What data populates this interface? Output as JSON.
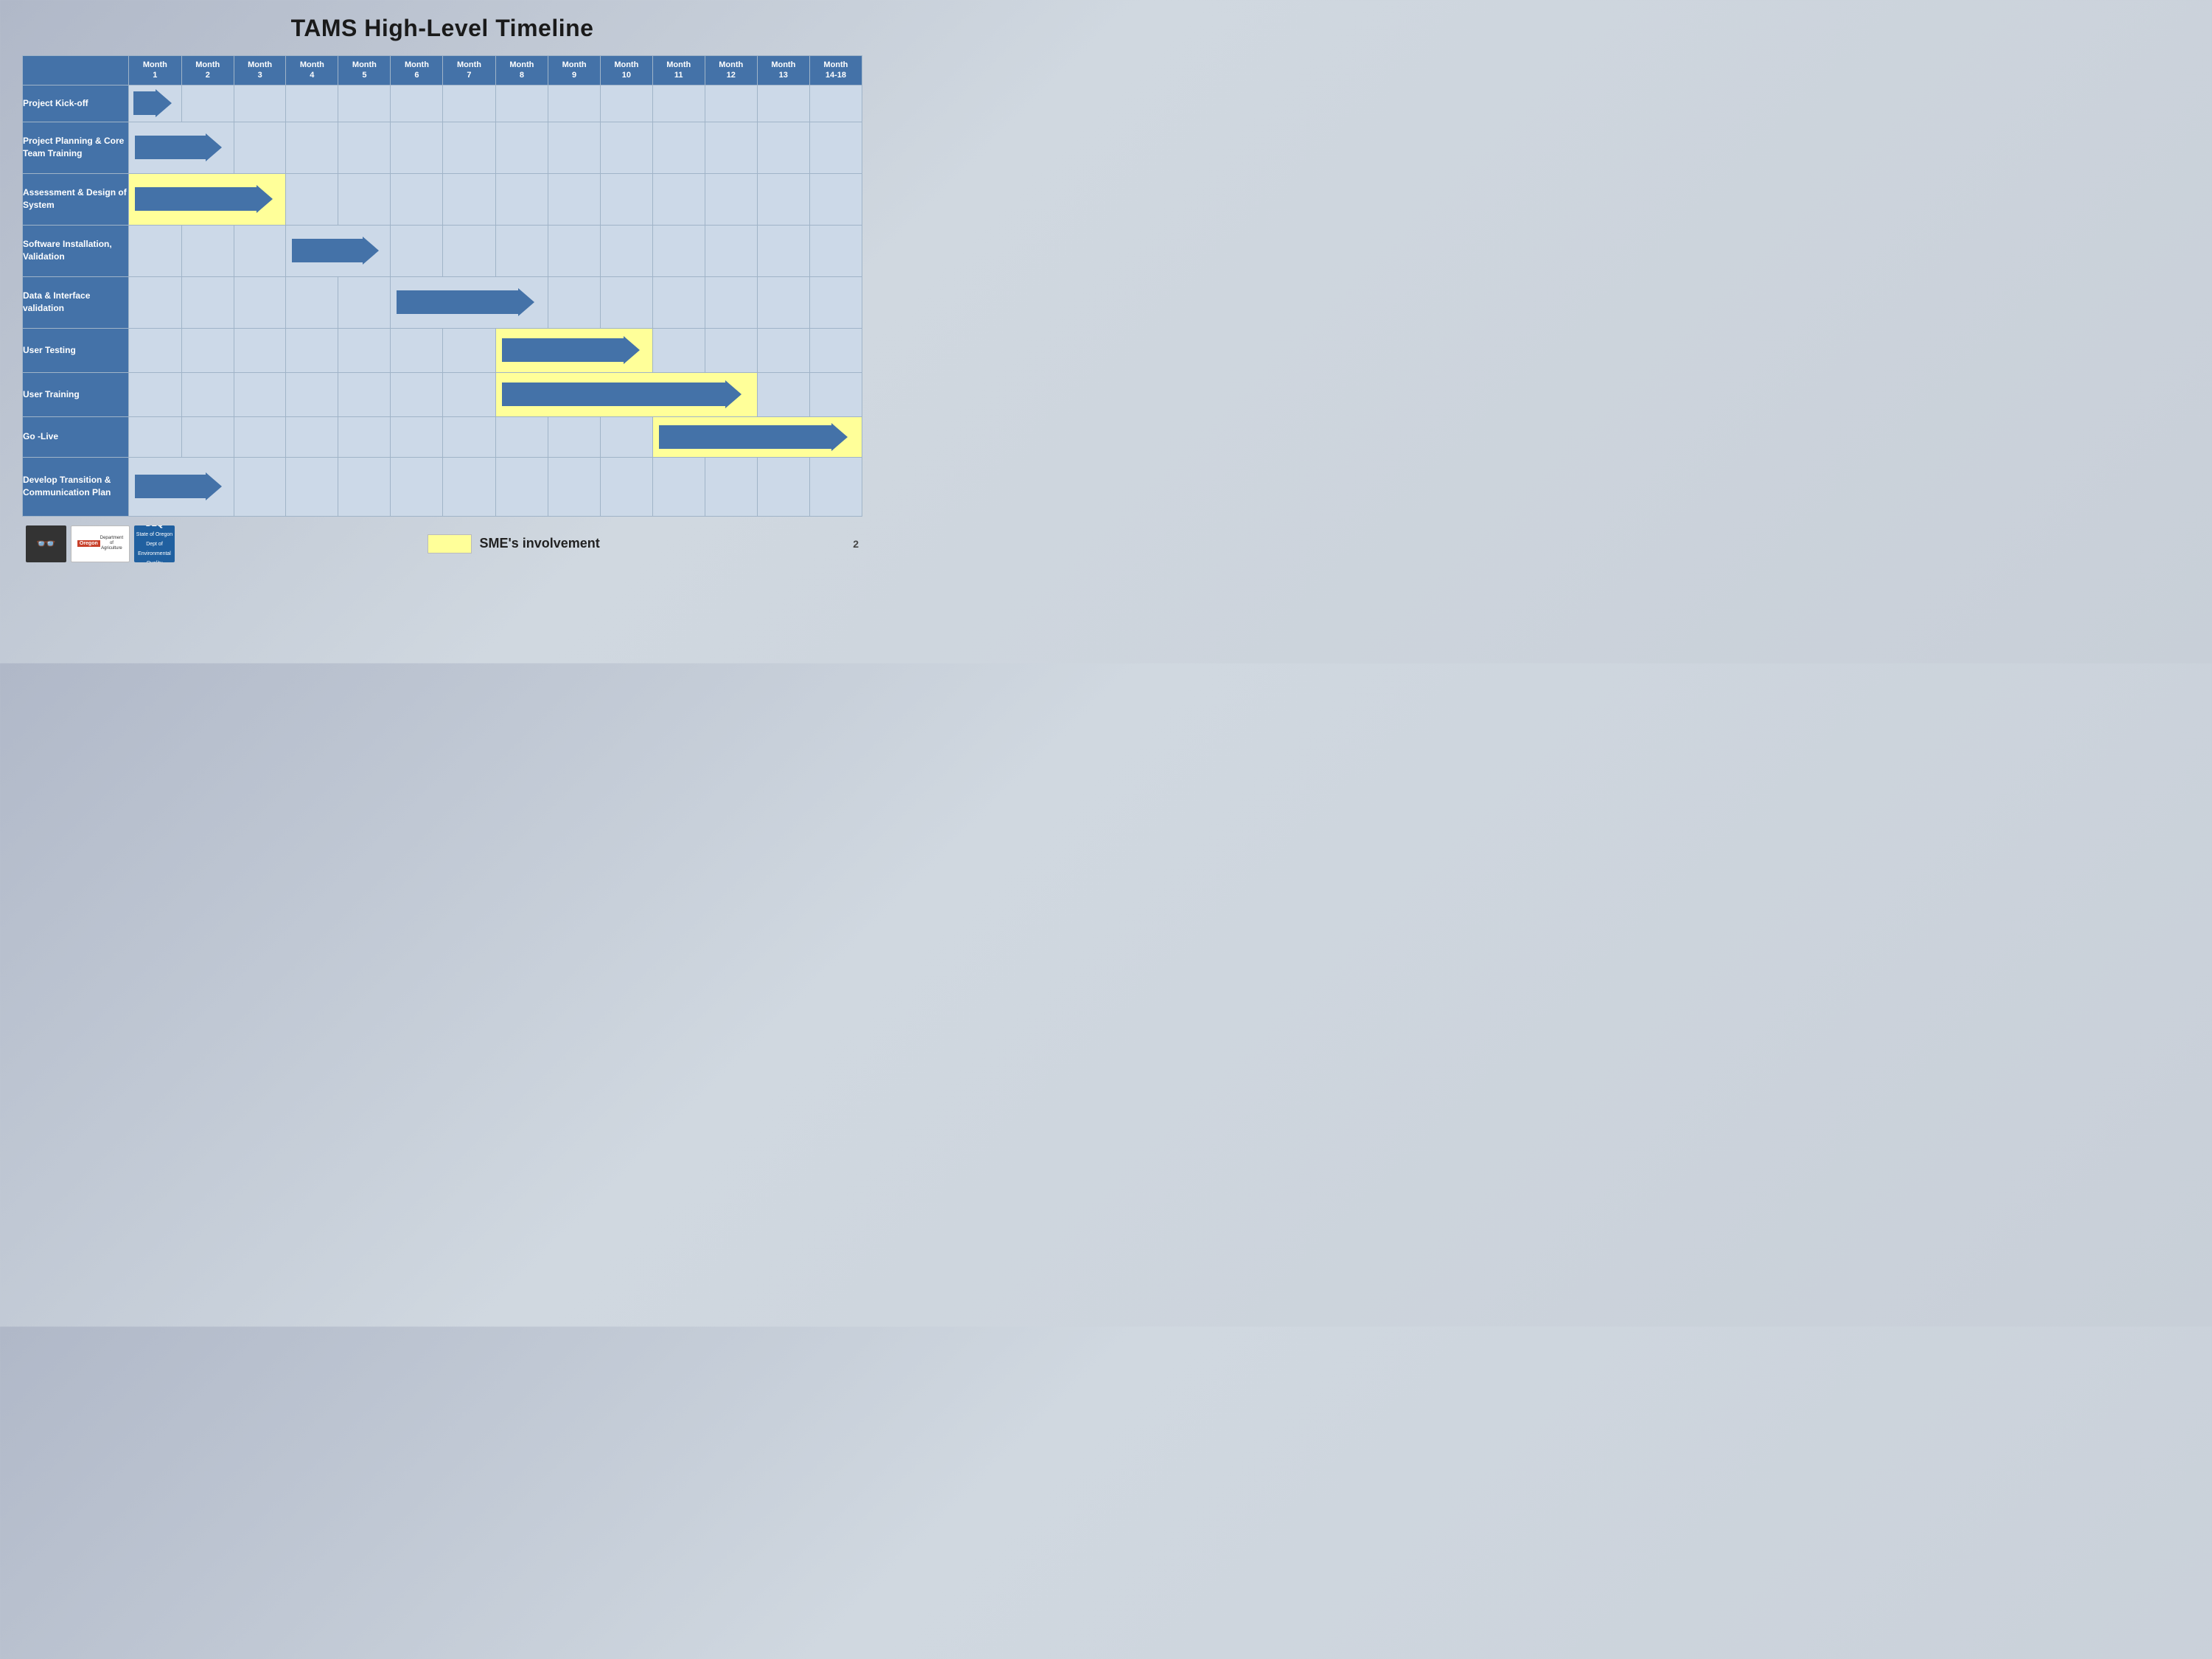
{
  "title": "TAMS High-Level Timeline",
  "months": [
    {
      "label": "Month",
      "num": "1"
    },
    {
      "label": "Month",
      "num": "2"
    },
    {
      "label": "Month",
      "num": "3"
    },
    {
      "label": "Month",
      "num": "4"
    },
    {
      "label": "Month",
      "num": "5"
    },
    {
      "label": "Month",
      "num": "6"
    },
    {
      "label": "Month",
      "num": "7"
    },
    {
      "label": "Month",
      "num": "8"
    },
    {
      "label": "Month",
      "num": "9"
    },
    {
      "label": "Month",
      "num": "10"
    },
    {
      "label": "Month",
      "num": "11"
    },
    {
      "label": "Month",
      "num": "12"
    },
    {
      "label": "Month",
      "num": "13"
    },
    {
      "label": "Month",
      "num": "14-18"
    }
  ],
  "tasks": [
    {
      "id": "kickoff",
      "label": "Project Kick-off",
      "arrow_start": 0,
      "arrow_span": 1,
      "yellow_cols": [],
      "row_class": "row-kickoff"
    },
    {
      "id": "planning",
      "label": "Project Planning & Core Team Training",
      "arrow_start": 0,
      "arrow_span": 2,
      "yellow_cols": [],
      "row_class": "row-planning"
    },
    {
      "id": "assessment",
      "label": "Assessment & Design of System",
      "arrow_start": 0,
      "arrow_span": 3,
      "yellow_cols": [
        0,
        1,
        2
      ],
      "row_class": "row-assessment"
    },
    {
      "id": "software",
      "label": "Software Installation, Validation",
      "arrow_start": 3,
      "arrow_span": 2,
      "yellow_cols": [],
      "row_class": "row-software"
    },
    {
      "id": "data",
      "label": "Data & Interface validation",
      "arrow_start": 5,
      "arrow_span": 3,
      "yellow_cols": [],
      "row_class": "row-data"
    },
    {
      "id": "usertesting",
      "label": "User Testing",
      "arrow_start": 7,
      "arrow_span": 3,
      "yellow_cols": [
        7,
        8,
        9
      ],
      "row_class": "row-usertesting"
    },
    {
      "id": "usertraining",
      "label": "User Training",
      "arrow_start": 7,
      "arrow_span": 5,
      "yellow_cols": [
        7,
        8,
        9,
        10,
        11
      ],
      "row_class": "row-usertraining"
    },
    {
      "id": "golive",
      "label": "Go -Live",
      "arrow_start": 10,
      "arrow_span": 4,
      "yellow_cols": [
        10,
        11,
        12,
        13
      ],
      "row_class": "row-golive"
    },
    {
      "id": "develop",
      "label": "Develop Transition & Communication Plan",
      "arrow_start": 0,
      "arrow_span": 2,
      "yellow_cols": [],
      "row_class": "row-develop"
    }
  ],
  "legend": {
    "swatch_label": "SME's involvement"
  },
  "footer": {
    "page_number": "2"
  }
}
